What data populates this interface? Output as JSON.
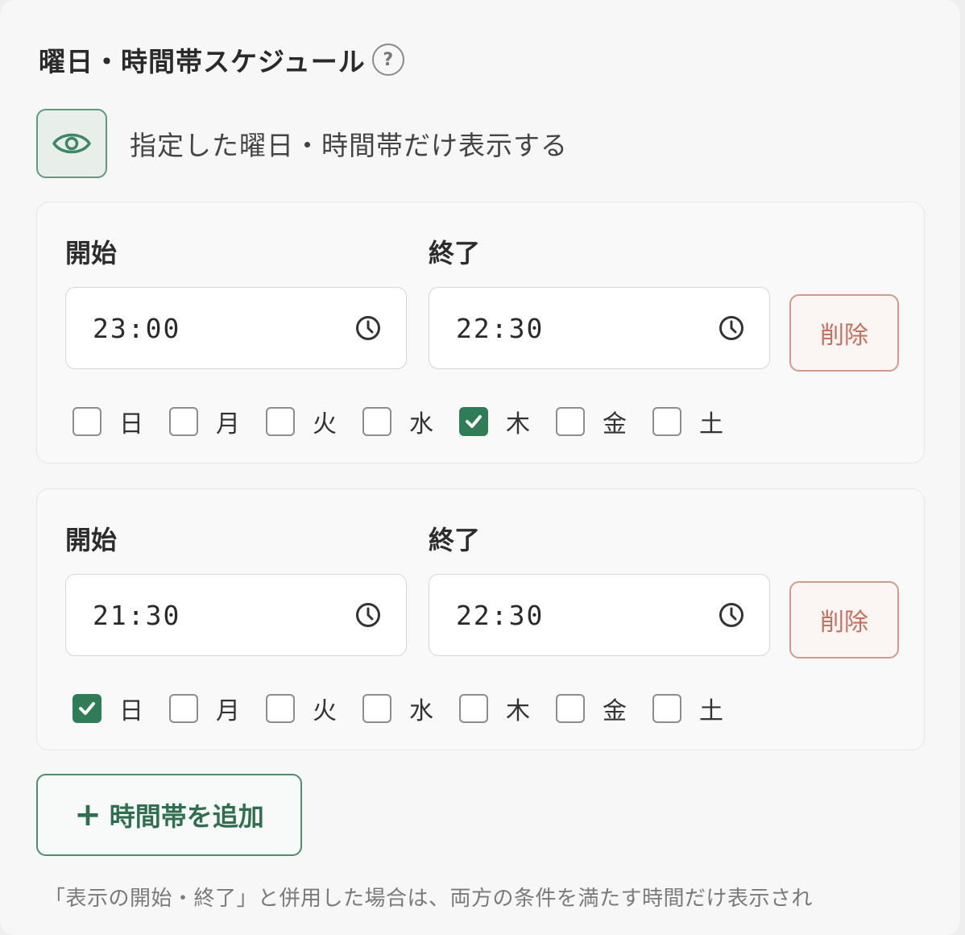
{
  "section": {
    "title": "曜日・時間帯スケジュール",
    "help_icon": "?"
  },
  "toggle": {
    "icon": "eye-icon",
    "label": "指定した曜日・時間帯だけ表示する",
    "accent_color": "#5e9a7c"
  },
  "schedules": [
    {
      "start_label": "開始",
      "start_value": "23:00",
      "end_label": "終了",
      "end_value": "22:30",
      "delete_label": "削除",
      "days": [
        {
          "label": "日",
          "checked": false
        },
        {
          "label": "月",
          "checked": false
        },
        {
          "label": "火",
          "checked": false
        },
        {
          "label": "水",
          "checked": false
        },
        {
          "label": "木",
          "checked": true
        },
        {
          "label": "金",
          "checked": false
        },
        {
          "label": "土",
          "checked": false
        }
      ]
    },
    {
      "start_label": "開始",
      "start_value": "21:30",
      "end_label": "終了",
      "end_value": "22:30",
      "delete_label": "削除",
      "days": [
        {
          "label": "日",
          "checked": true
        },
        {
          "label": "月",
          "checked": false
        },
        {
          "label": "火",
          "checked": false
        },
        {
          "label": "水",
          "checked": false
        },
        {
          "label": "木",
          "checked": false
        },
        {
          "label": "金",
          "checked": false
        },
        {
          "label": "土",
          "checked": false
        }
      ]
    }
  ],
  "add_button": {
    "plus": "+",
    "label": "時間帯を追加"
  },
  "note": "「表示の開始・終了」と併用した場合は、両方の条件を満たす時間だけ表示され",
  "colors": {
    "checked": "#2e7d57",
    "delete": "#c8705e",
    "add": "#2f6f50"
  }
}
